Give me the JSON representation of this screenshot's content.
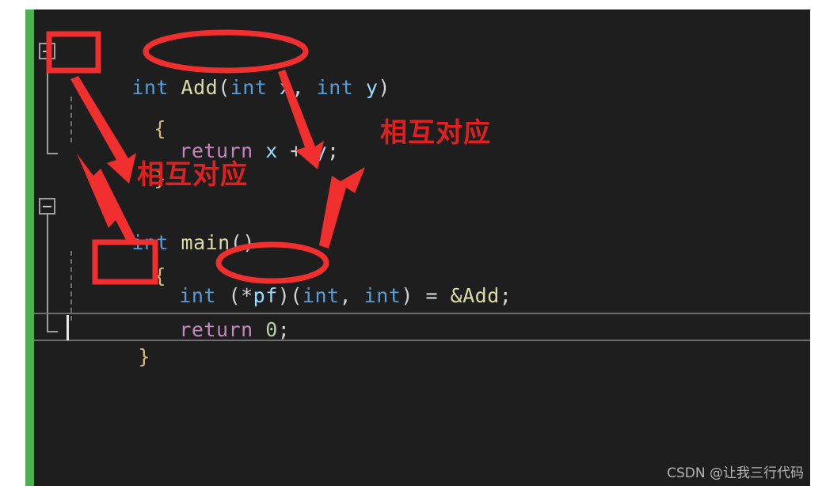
{
  "editor": {
    "theme_background": "#1e1e1e",
    "change_bar_color": "#4caf50",
    "annotation_color": "#e02020",
    "code_lines": [
      {
        "id": "line1",
        "text": "int Add(int x, int y)"
      },
      {
        "id": "line2",
        "text": "{"
      },
      {
        "id": "line3",
        "text": "    return x + y;"
      },
      {
        "id": "line4",
        "text": "}"
      },
      {
        "id": "line5",
        "text": "int main()"
      },
      {
        "id": "line6",
        "text": "{"
      },
      {
        "id": "line7",
        "text": "    int (*pf)(int, int) = &Add;"
      },
      {
        "id": "line8",
        "text": "    return 0;"
      },
      {
        "id": "line9",
        "text": "}"
      }
    ],
    "tokens": {
      "kw_int": "int",
      "fn_add": "Add",
      "fn_main": "main",
      "kw_return": "return",
      "var_x": "x",
      "var_y": "y",
      "var_pf": "pf",
      "num_zero": "0",
      "open_paren": "(",
      "close_paren": ")",
      "open_brace": "{",
      "close_brace": "}",
      "comma_space": ", ",
      "semicolon": ";",
      "space": " ",
      "plus": "+",
      "assign": "=",
      "amp_add": "&Add",
      "star": "*",
      "indent": "    ",
      "l1_add_params_open": "(",
      "l1_add_params_close": ")",
      "l7_pf_open": "(",
      "l7_pf_close": ")",
      "l7_params_open": "(",
      "l7_params_close": ")"
    }
  },
  "annotations": {
    "label_top": "相互对应",
    "label_bottom": "相互对应",
    "highlight_boxes": [
      {
        "name": "return-type-add",
        "label": "int"
      },
      {
        "name": "return-type-pf",
        "label": "int"
      }
    ],
    "ellipses": [
      {
        "name": "params-add",
        "label": "int x, int y"
      },
      {
        "name": "params-pf",
        "label": "int, int"
      }
    ]
  },
  "watermark": {
    "text": "CSDN @让我三行代码"
  }
}
